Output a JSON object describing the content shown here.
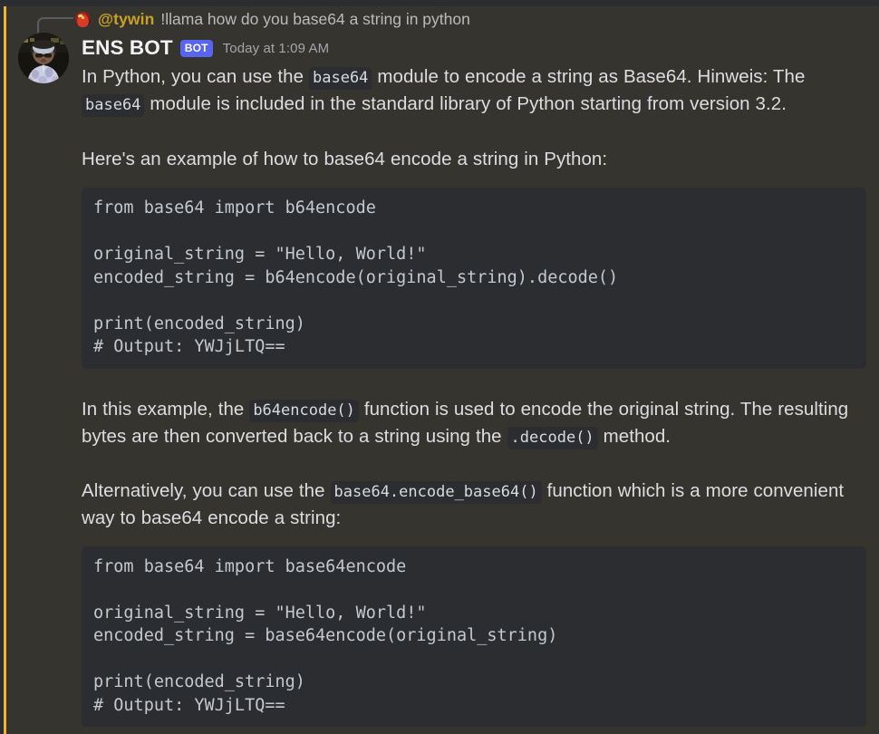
{
  "theme": {
    "mention_background": "#36342e",
    "mention_bar": "#f0b232",
    "code_background": "#2b2d31",
    "bot_badge_color": "#5865f2",
    "reply_name_color": "#c7a227",
    "text_color": "#dbdee1"
  },
  "reply": {
    "avatar_icon": "flame-avatar-icon",
    "username": "@tywin",
    "message": "!llama how do you base64 a string in python"
  },
  "message": {
    "avatar_icon": "user-avatar-photo",
    "author": "ENS BOT",
    "bot_badge": "BOT",
    "timestamp": "Today at 1:09 AM",
    "paragraph1": {
      "part1": "In Python, you can use the ",
      "code1": "base64",
      "part2": " module to encode a string as Base64. Hinweis: The ",
      "code2": "base64",
      "part3": " module is included in the standard library of Python starting from version 3.2."
    },
    "paragraph2": "Here's an example of how to base64 encode a string in Python:",
    "code_block_1": "from base64 import b64encode\n\noriginal_string = \"Hello, World!\"\nencoded_string = b64encode(original_string).decode()\n\nprint(encoded_string)\n# Output: YWJjLTQ==",
    "paragraph3": {
      "part1": "In this example, the ",
      "code1": "b64encode()",
      "part2": " function is used to encode the original string. The resulting bytes are then converted back to a string using the ",
      "code2": ".decode()",
      "part3": " method."
    },
    "paragraph4": {
      "part1": "Alternatively, you can use the ",
      "code1": "base64.encode_base64()",
      "part2": " function which is a more convenient way to base64 encode a string:"
    },
    "code_block_2": "from base64 import base64encode\n\noriginal_string = \"Hello, World!\"\nencoded_string = base64encode(original_string)\n\nprint(encoded_string)\n# Output: YWJjLTQ=="
  }
}
